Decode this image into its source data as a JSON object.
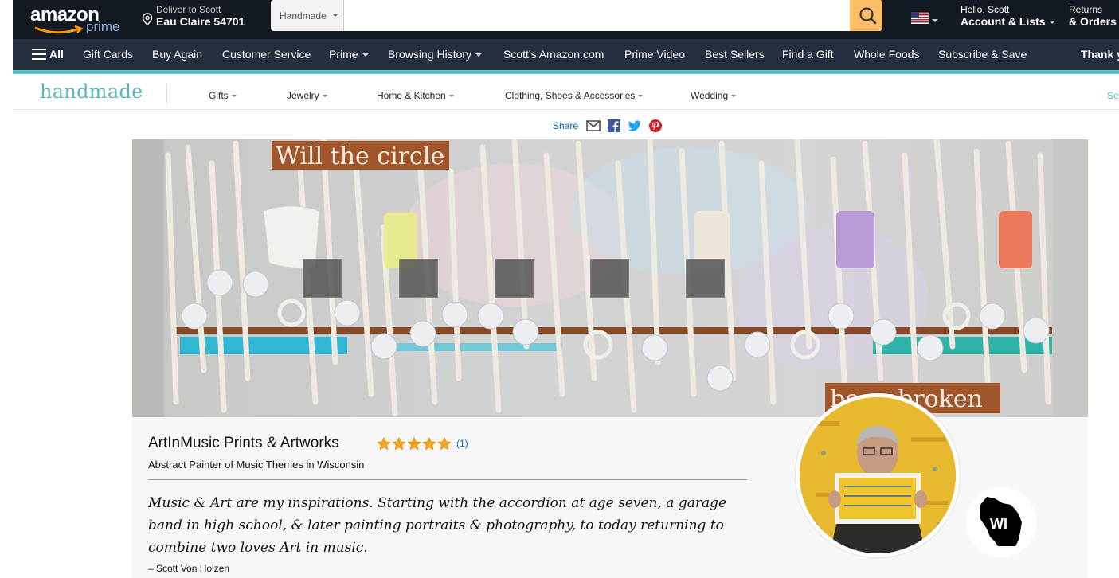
{
  "topbar": {
    "logo_text": "amazon",
    "logo_sub": "prime",
    "deliver_line1": "Deliver to Scott",
    "deliver_line2": "Eau Claire 54701",
    "search_dept": "Handmade",
    "search_value": "",
    "account_line1": "Hello, Scott",
    "account_line2": "Account & Lists",
    "returns_line1": "Returns",
    "returns_line2": "& Orders"
  },
  "navbar": {
    "all_label": "All",
    "items": [
      {
        "label": "Gift Cards",
        "caret": false
      },
      {
        "label": "Buy Again",
        "caret": false
      },
      {
        "label": "Customer Service",
        "caret": false
      },
      {
        "label": "Prime",
        "caret": true
      },
      {
        "label": "Browsing History",
        "caret": true
      },
      {
        "label": "Scott's Amazon.com",
        "caret": false
      },
      {
        "label": "Prime Video",
        "caret": false
      },
      {
        "label": "Best Sellers",
        "caret": false
      },
      {
        "label": "Find a Gift",
        "caret": false
      },
      {
        "label": "Whole Foods",
        "caret": false
      },
      {
        "label": "Subscribe & Save",
        "caret": false
      },
      {
        "label": "Thank y",
        "caret": false
      }
    ]
  },
  "subnav": {
    "logo": "handmade",
    "categories": [
      "Gifts",
      "Jewelry",
      "Home & Kitchen",
      "Clothing, Shoes & Accessories",
      "Wedding"
    ],
    "sell_label": "Sel"
  },
  "share": {
    "label": "Share"
  },
  "banner": {
    "sign_top": "Will the circle",
    "sign_bottom": "be unbroken"
  },
  "shop": {
    "name": "ArtInMusic Prints & Artworks",
    "rating": 5,
    "rating_count": "(1)",
    "tagline": "Abstract Painter of Music Themes in Wisconsin",
    "quote": "Music & Art are my inspirations. Starting with the accordion at age seven, a garage band in high school, & later painting portraits & photography, to today returning to combine two loves Art in music.",
    "author": "– Scott Von Holzen",
    "state_abbr": "WI"
  },
  "colors": {
    "topbar_bg": "#131921",
    "navbar_bg": "#232f3e",
    "search_button": "#febd69",
    "handmade_teal": "#5ab7bb",
    "link_blue": "#0066c0",
    "star_gold": "#f4a622"
  }
}
